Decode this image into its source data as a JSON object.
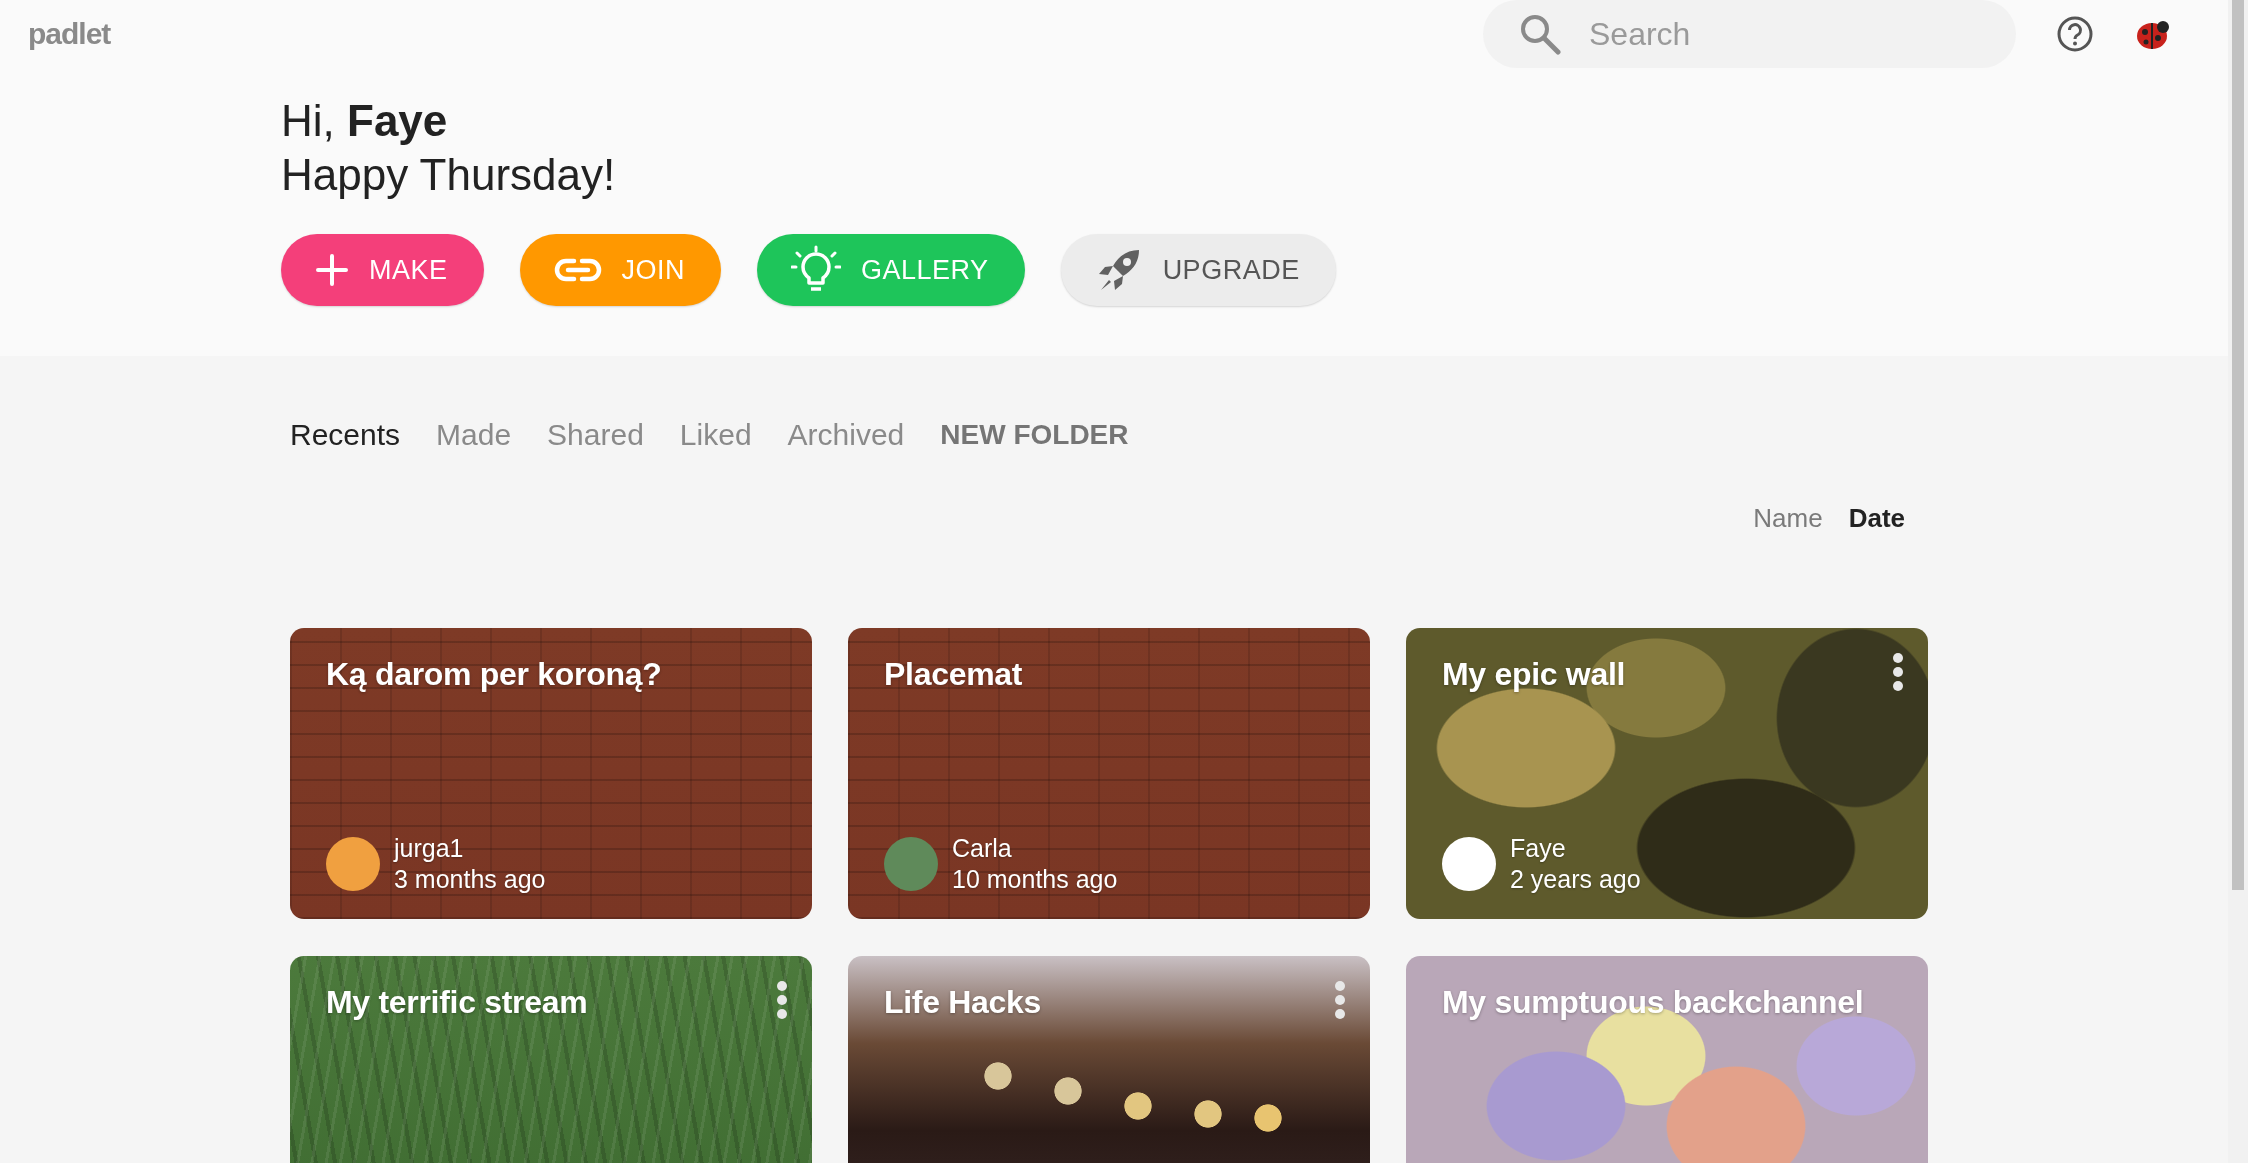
{
  "logo": "padlet",
  "search": {
    "placeholder": "Search"
  },
  "greeting": {
    "text": "Hi, **Faye**",
    "subtitle": "Happy Thursday!"
  },
  "actions": [
    {
      "label": "MAKE",
      "kind": "make"
    },
    {
      "label": "JOIN",
      "kind": "join"
    },
    {
      "label": "GALLERY",
      "kind": "gallery"
    },
    {
      "label": "UPGRADE",
      "kind": "upgrade"
    }
  ],
  "tabs": [
    {
      "label": "Recents",
      "selected": true,
      "kind": "tab"
    },
    {
      "label": "Made",
      "selected": false,
      "kind": "tab"
    },
    {
      "label": "Shared",
      "selected": false,
      "kind": "tab"
    },
    {
      "label": "Liked",
      "selected": false,
      "kind": "tab"
    },
    {
      "label": "Archived",
      "selected": false,
      "kind": "tab"
    },
    {
      "label": "NEW FOLDER",
      "kind": "action"
    }
  ],
  "sort": [
    {
      "label": "Name",
      "selected": false
    },
    {
      "label": "Date",
      "selected": true
    }
  ],
  "cards": [
    {
      "title": "Ką darom per koroną?",
      "kind": "brick",
      "menu": false,
      "author": {
        "name": "jurga1",
        "time": "3 months ago",
        "color": "#f0a040"
      }
    },
    {
      "title": "Placemat",
      "kind": "brick",
      "menu": false,
      "author": {
        "name": "Carla",
        "time": "10 months ago",
        "color": "#5f8a5a"
      }
    },
    {
      "title": "My epic wall",
      "kind": "camo",
      "menu": true,
      "author": {
        "name": "Faye",
        "time": "2 years ago",
        "color": "#ffffff"
      }
    },
    {
      "title": "My terrific stream",
      "kind": "grass",
      "menu": true
    },
    {
      "title": "Life Hacks",
      "kind": "bokeh",
      "menu": true
    },
    {
      "title": "My sumptuous backchannel",
      "kind": "candy",
      "menu": false
    }
  ]
}
